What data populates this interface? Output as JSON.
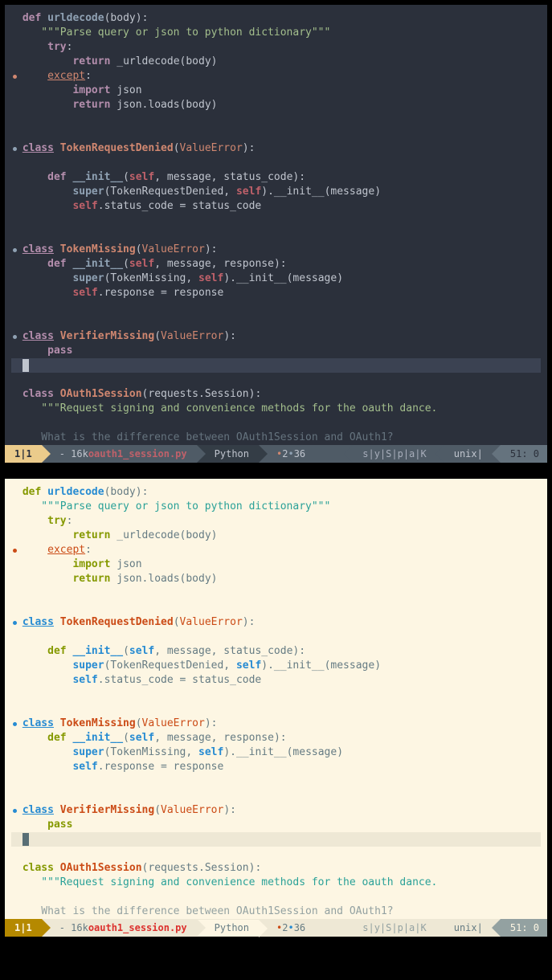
{
  "code": {
    "l1_def": "def",
    "l1_fn": "urldecode",
    "l1_lp": "(",
    "l1_p": "body",
    "l1_rp": ")",
    "l1_c": ":",
    "l2": "    \"\"\"Parse query or json to python dictionary\"\"\"",
    "l3_kw": "try",
    "l3_c": ":",
    "l4_ret": "return",
    "l4_fn": " _urldecode",
    "l4_lp": "(",
    "l4_p": "body",
    "l4_rp": ")",
    "l5_kw": "except",
    "l5_c": ":",
    "l6_kw": "import",
    "l6_t": " json",
    "l7_ret": "return",
    "l7_t": " json.loads",
    "l7_lp": "(",
    "l7_p": "body",
    "l7_rp": ")",
    "l8_cls": "class",
    "l8_n": " TokenRequestDenied",
    "l8_lp": "(",
    "l8_t": "ValueError",
    "l8_rp": ")",
    "l8_c": ":",
    "l9_def": "def",
    "l9_fn": " __init__",
    "l9_lp": "(",
    "l9_s": "self",
    "l9_p": ", message, status_code",
    "l9_rp": ")",
    "l9_c": ":",
    "l10_sup": "super",
    "l10_lp": "(",
    "l10_t": "TokenRequestDenied, ",
    "l10_s": "self",
    "l10_rp": ")",
    "l10_i": ".__init__",
    "l10_lp2": "(",
    "l10_p": "message",
    "l10_rp2": ")",
    "l11_s": "self",
    "l11_t": ".status_code = status_code",
    "l12_cls": "class",
    "l12_n": " TokenMissing",
    "l12_lp": "(",
    "l12_t": "ValueError",
    "l12_rp": ")",
    "l12_c": ":",
    "l13_def": "def",
    "l13_fn": " __init__",
    "l13_lp": "(",
    "l13_s": "self",
    "l13_p": ", message, response",
    "l13_rp": ")",
    "l13_c": ":",
    "l14_sup": "super",
    "l14_lp": "(",
    "l14_t": "TokenMissing, ",
    "l14_s": "self",
    "l14_rp": ")",
    "l14_i": ".__init__",
    "l14_lp2": "(",
    "l14_p": "message",
    "l14_rp2": ")",
    "l15_s": "self",
    "l15_t": ".response = response",
    "l16_cls": "class",
    "l16_n": " VerifierMissing",
    "l16_lp": "(",
    "l16_t": "ValueError",
    "l16_rp": ")",
    "l16_c": ":",
    "l17": "pass",
    "l18_cls": "class",
    "l18_n": " OAuth1Session",
    "l18_lp": "(",
    "l18_t": "requests.Session",
    "l18_rp": ")",
    "l18_c": ":",
    "l19": "    \"\"\"Request signing and convenience methods for the oauth dance.",
    "l20": "    What is the difference between OAuth1Session and OAuth1?"
  },
  "status": {
    "mode": "1|1",
    "size_prefix": "- 16k ",
    "filename": "oauth1_session.py",
    "filetype": "Python",
    "warn_count": "2",
    "err_count": "36",
    "toggles": "s|y|S|p|a|K",
    "encoding": "unix",
    "position": "51: 0"
  }
}
